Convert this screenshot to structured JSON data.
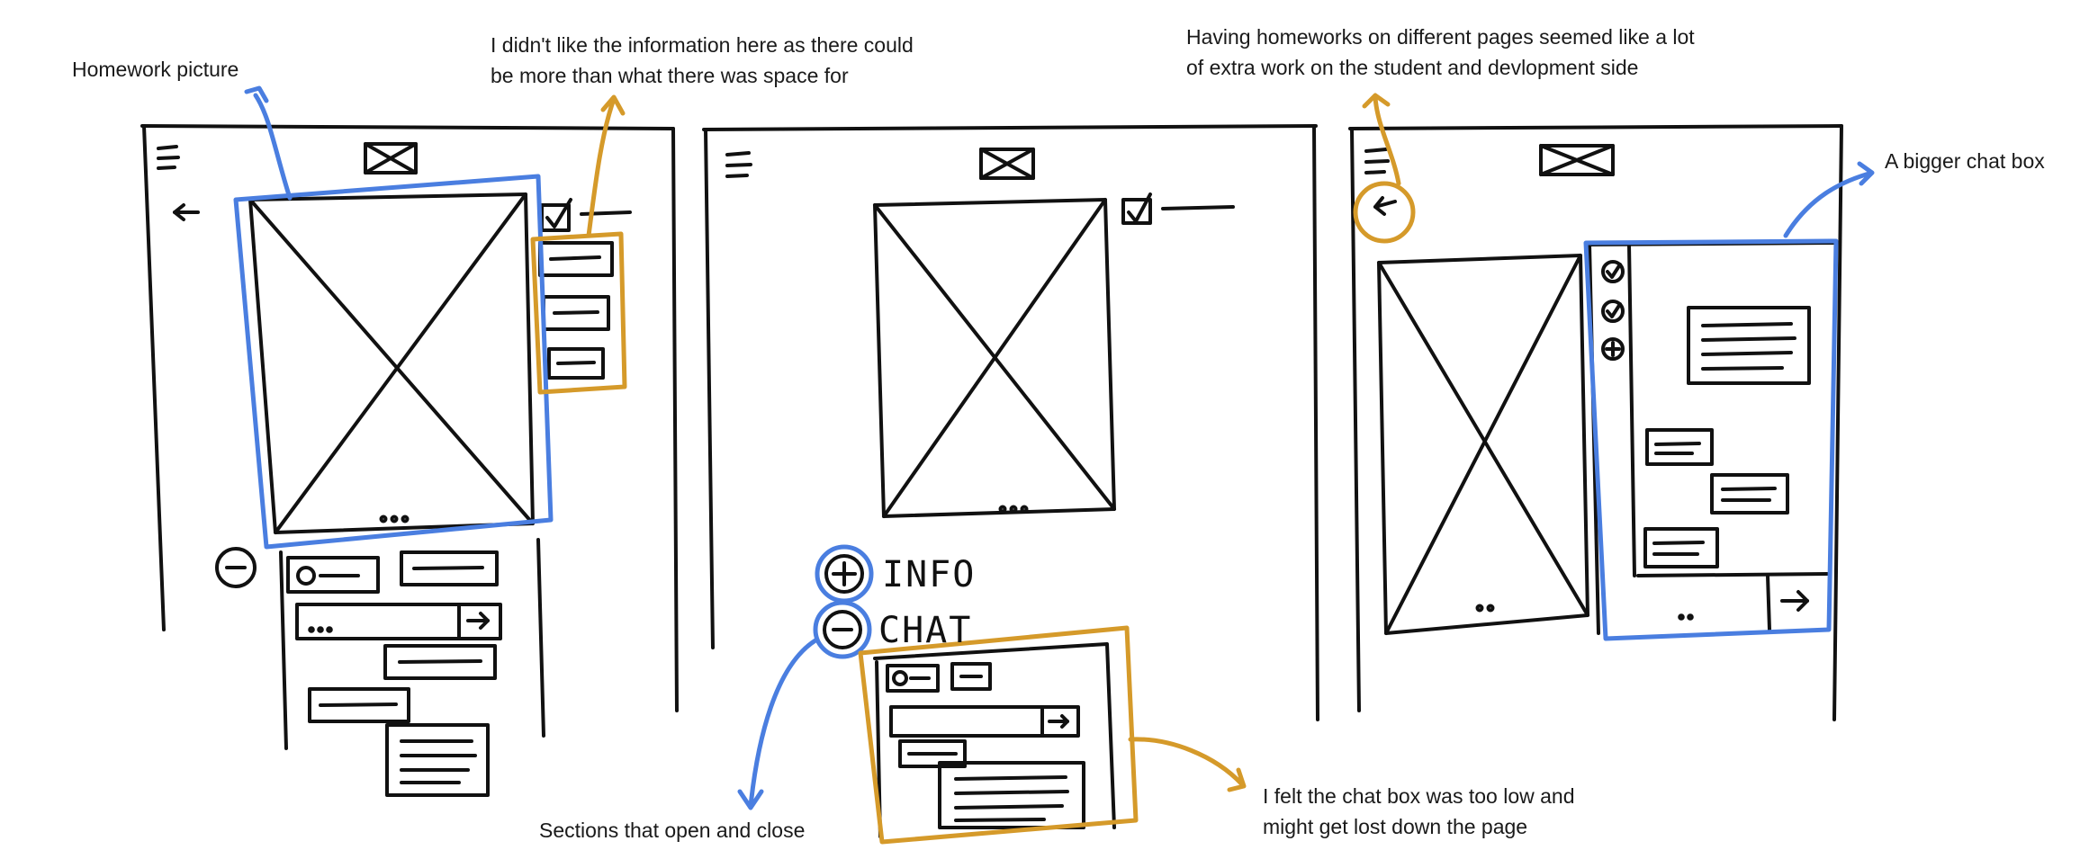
{
  "annotations": {
    "homework_picture": "Homework picture",
    "info_space_line1": "I didn't like the information here as there could",
    "info_space_line2": "be more than what there was space for",
    "homeworks_pages_line1": "Having homeworks on different pages seemed like a lot",
    "homeworks_pages_line2": "of extra work on the student and devlopment side",
    "bigger_chat_box": "A bigger chat box",
    "sections_open_close": "Sections that open and close",
    "chat_low_line1": "I felt the chat box was too low and",
    "chat_low_line2": "might get lost down the page"
  },
  "sketch_labels": {
    "info": "INFO",
    "chat": "CHAT",
    "ellipsis": "...",
    "send_arrow": "→"
  },
  "colors": {
    "ink": "#111111",
    "blue_highlight": "#4a7ee0",
    "gold_highlight": "#d59a2a",
    "paper": "#ffffff"
  }
}
